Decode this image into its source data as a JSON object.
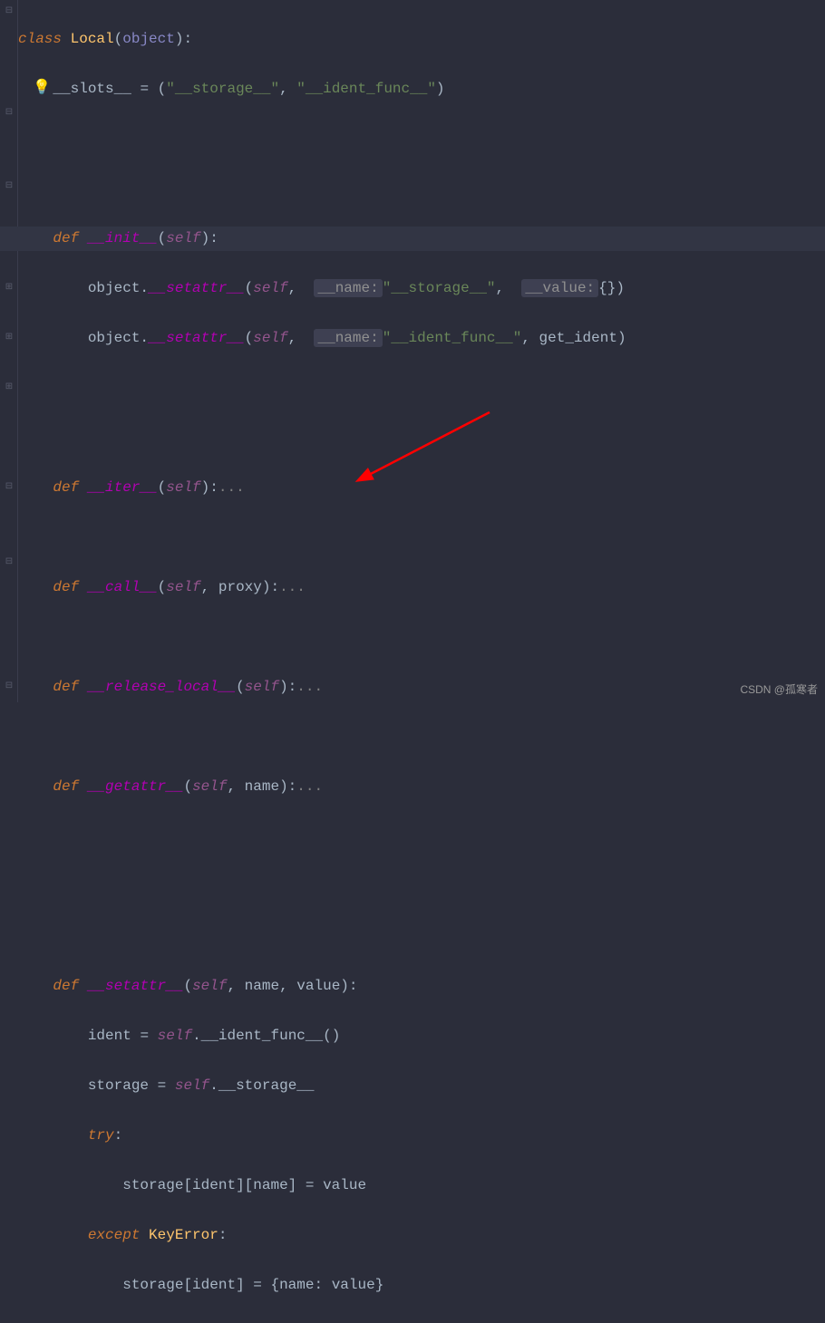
{
  "code": {
    "class_kw": "class",
    "class_name": "Local",
    "object_builtin": "object",
    "slots_name": "__slots__",
    "slots_val1": "\"__storage__\"",
    "slots_val2": "\"__ident_func__\"",
    "def_kw": "def",
    "init_name": "__init__",
    "self_kw": "self",
    "object_ref": "object",
    "setattr_fn": "__setattr__",
    "hint_name_label": "__name:",
    "hint_value_label": "__value:",
    "storage_str": "\"__storage__\"",
    "empty_dict": "{}",
    "ident_func_str": "\"__ident_func__\"",
    "get_ident": "get_ident",
    "iter_name": "__iter__",
    "call_name": "__call__",
    "proxy_param": "proxy",
    "release_local_name": "__release_local__",
    "getattr_name": "__getattr__",
    "name_param": "name",
    "setattr_name": "__setattr__",
    "value_param": "value",
    "ident_var": "ident",
    "ident_func_attr": "__ident_func__",
    "storage_var": "storage",
    "storage_attr": "__storage__",
    "try_kw": "try",
    "except_kw": "except",
    "keyerror": "KeyError",
    "ellipsis": "..."
  },
  "watermark": "CSDN @孤寒者"
}
